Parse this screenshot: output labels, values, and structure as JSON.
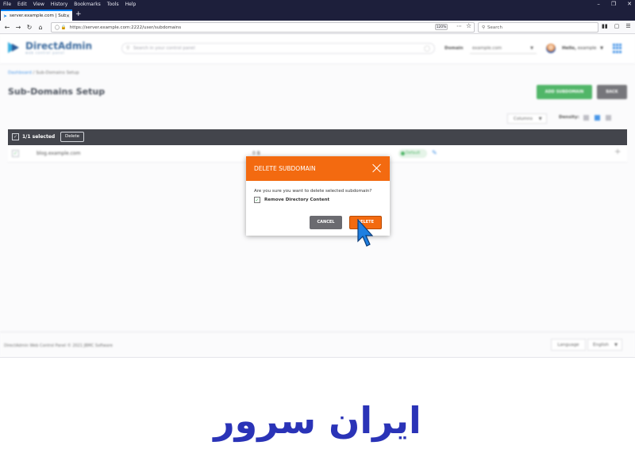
{
  "browser": {
    "menu": [
      "File",
      "Edit",
      "View",
      "History",
      "Bookmarks",
      "Tools",
      "Help"
    ],
    "tab_title": "server.example.com | Sub-Dom...",
    "url": "https://server.example.com:2222/user/subdomains",
    "zoom": "120%",
    "search_placeholder": "Search"
  },
  "header": {
    "logo_name": "DirectAdmin",
    "logo_tagline": "web control panel",
    "search_placeholder": "Search in your control panel",
    "domain_label": "Domain",
    "domain_value": "example.com",
    "greeting": "Hello,",
    "username": "example"
  },
  "page": {
    "breadcrumb_link": "Dashboard",
    "breadcrumb_current": "/ Sub-Domains Setup",
    "title": "Sub-Domains Setup",
    "add_button": "ADD SUBDOMAIN",
    "back_button": "BACK",
    "columns_button": "Columns",
    "density_label": "Density:"
  },
  "selection": {
    "count": "1/1 selected",
    "delete_label": "Delete"
  },
  "table": {
    "rows": [
      {
        "domain": "blog.example.com",
        "usage": "0 B",
        "status": "Default"
      }
    ]
  },
  "modal": {
    "title": "DELETE SUBDOMAIN",
    "question": "Are you sure you want to delete selected subdomain?",
    "checkbox_label": "Remove Directory Content",
    "cancel_label": "CANCEL",
    "delete_label": "DELETE"
  },
  "footer": {
    "text": "DirectAdmin Web Control Panel © 2021 JBMC Software",
    "language_label": "Language",
    "language_value": "English"
  },
  "brand": {
    "logo_text": "ایران سرور"
  },
  "colors": {
    "accent": "#f36a10",
    "success": "#43b05c",
    "link": "#3a8ee6",
    "brand": "#2a33b7"
  }
}
